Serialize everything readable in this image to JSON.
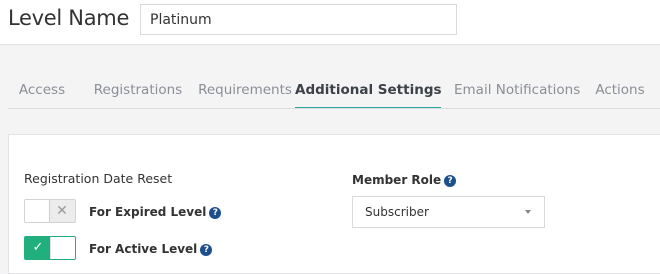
{
  "header": {
    "level_label": "Level Name",
    "level_name_value": "Platinum"
  },
  "tabs": [
    {
      "label": "Access",
      "active": false
    },
    {
      "label": "Registrations",
      "active": false
    },
    {
      "label": "Requirements",
      "active": false
    },
    {
      "label": "Additional Settings",
      "active": true
    },
    {
      "label": "Email Notifications",
      "active": false
    },
    {
      "label": "Actions",
      "active": false
    }
  ],
  "registration_date_reset": {
    "title": "Registration Date Reset",
    "toggles": [
      {
        "label": "For Expired Level",
        "state": "off",
        "icon": "x-icon"
      },
      {
        "label": "For Active Level",
        "state": "on",
        "icon": "check-icon"
      }
    ],
    "help_glyph": "?"
  },
  "member_role": {
    "title": "Member Role",
    "selected": "Subscriber"
  },
  "colors": {
    "accent_tab": "#2aa5a0",
    "toggle_on": "#21b07d",
    "help_icon": "#1c4f8c"
  }
}
